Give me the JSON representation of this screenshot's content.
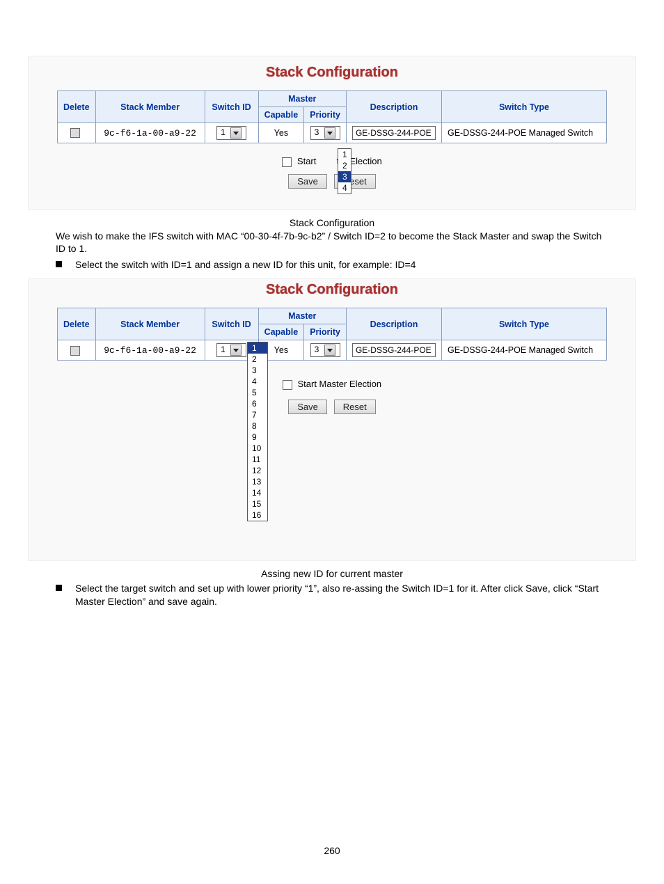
{
  "panel1": {
    "title": "Stack Configuration",
    "headers": {
      "delete": "Delete",
      "stack_member": "Stack Member",
      "switch_id": "Switch ID",
      "master": "Master",
      "capable": "Capable",
      "priority": "Priority",
      "description": "Description",
      "switch_type": "Switch Type"
    },
    "row": {
      "mac": "9c-f6-1a-00-a9-22",
      "switch_id": "1",
      "capable": "Yes",
      "priority": "3",
      "description": "GE-DSSG-244-POE",
      "switch_type": "GE-DSSG-244-POE Managed Switch"
    },
    "priority_options": [
      "1",
      "2",
      "3",
      "4"
    ],
    "start_label_left": "Start",
    "start_label_right": "ter Election",
    "save": "Save",
    "reset": "Reset"
  },
  "caption1": "Stack Configuration",
  "para1": "We wish to make the IFS switch with MAC “00-30-4f-7b-9c-b2” / Switch ID=2 to become the Stack Master and swap the Switch ID to 1.",
  "bullet1": "Select the switch with ID=1 and assign a new ID for this unit, for example: ID=4",
  "panel2": {
    "title": "Stack Configuration",
    "headers": {
      "delete": "Delete",
      "stack_member": "Stack Member",
      "switch_id": "Switch ID",
      "master": "Master",
      "capable": "Capable",
      "priority": "Priority",
      "description": "Description",
      "switch_type": "Switch Type"
    },
    "row": {
      "mac": "9c-f6-1a-00-a9-22",
      "switch_id": "1",
      "capable": "Yes",
      "priority": "3",
      "description": "GE-DSSG-244-POE",
      "switch_type": "GE-DSSG-244-POE Managed Switch"
    },
    "switch_id_options": [
      "1",
      "2",
      "3",
      "4",
      "5",
      "6",
      "7",
      "8",
      "9",
      "10",
      "11",
      "12",
      "13",
      "14",
      "15",
      "16"
    ],
    "start_label": "Start Master Election",
    "save": "Save",
    "reset": "Reset"
  },
  "caption2": "Assing new ID for current master",
  "bullet2": "Select the target switch and set up with lower priority “1”, also re-assing the Switch ID=1 for it. After click Save, click “Start Master Election” and save again.",
  "page_num": "260"
}
